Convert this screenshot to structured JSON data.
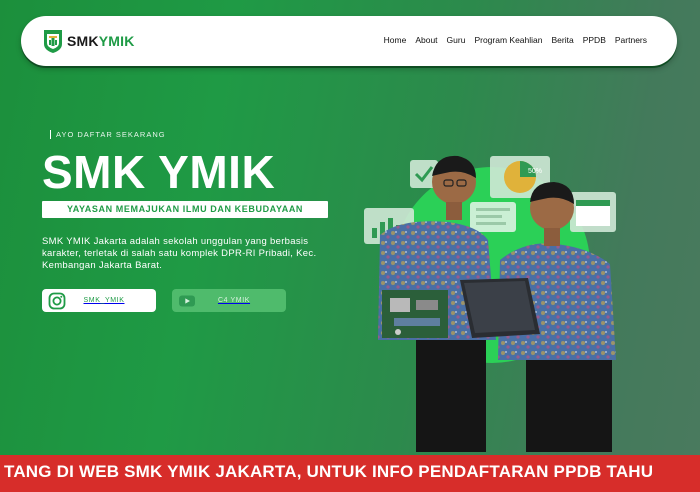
{
  "brand": {
    "part1": "SMK",
    "part2": "YMIK",
    "icon": "school-shield-logo-icon"
  },
  "nav": [
    "Home",
    "About",
    "Guru",
    "Program Keahlian",
    "Berita",
    "PPDB",
    "Partners"
  ],
  "hero": {
    "eyebrow": "AYO DAFTAR SEKARANG",
    "title": "SMK YMIK",
    "ribbon": "YAYASAN MEMAJUKAN ILMU DAN KEBUDAYAAN",
    "description": "SMK YMIK Jakarta adalah sekolah unggulan yang berbasis karakter, terletak di salah satu komplek DPR-RI Pribadi, Kec. Kembangan Jakarta Barat."
  },
  "social": {
    "instagram": {
      "label": "SMK_YMIK",
      "icon": "instagram-icon"
    },
    "youtube": {
      "label": "C4 YMIK",
      "icon": "youtube-icon"
    }
  },
  "ticker": {
    "text": "TANG DI WEB SMK YMIK JAKARTA, UNTUK INFO PENDAFTARAN PPDB TAHU"
  },
  "colors": {
    "primary": "#1f9b46",
    "ticker": "#d72d2a",
    "white": "#ffffff"
  }
}
